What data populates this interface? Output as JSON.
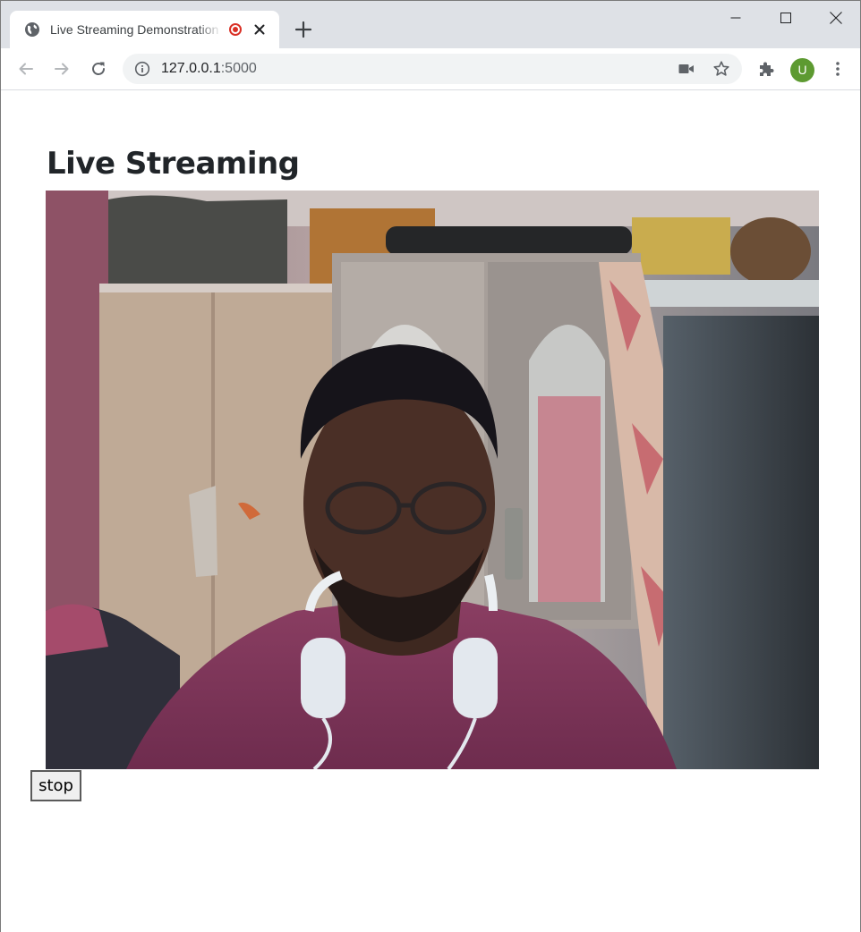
{
  "browser": {
    "tab": {
      "title": "Live Streaming Demonstration",
      "favicon": "globe-icon",
      "recording_indicator": "recording-dot-icon",
      "close_icon": "close-icon"
    },
    "new_tab_icon": "plus-icon",
    "window_controls": [
      "minimize-icon",
      "maximize-icon",
      "close-icon"
    ],
    "toolbar": {
      "back_icon": "arrow-left-icon",
      "forward_icon": "arrow-right-icon",
      "reload_icon": "reload-icon",
      "site_info_icon": "info-icon",
      "url_host": "127.0.0.1",
      "url_port": ":5000",
      "camera_icon": "video-camera-icon",
      "bookmark_icon": "star-icon",
      "extensions_icon": "puzzle-icon",
      "profile_initial": "U",
      "menu_icon": "kebab-menu-icon"
    },
    "colors": {
      "tabstrip": "#dee1e6",
      "recording": "#d93025",
      "avatar": "#5d9a31"
    }
  },
  "page": {
    "heading": "Live Streaming",
    "video_feed": "webcam-stream",
    "stop_label": "stop"
  }
}
